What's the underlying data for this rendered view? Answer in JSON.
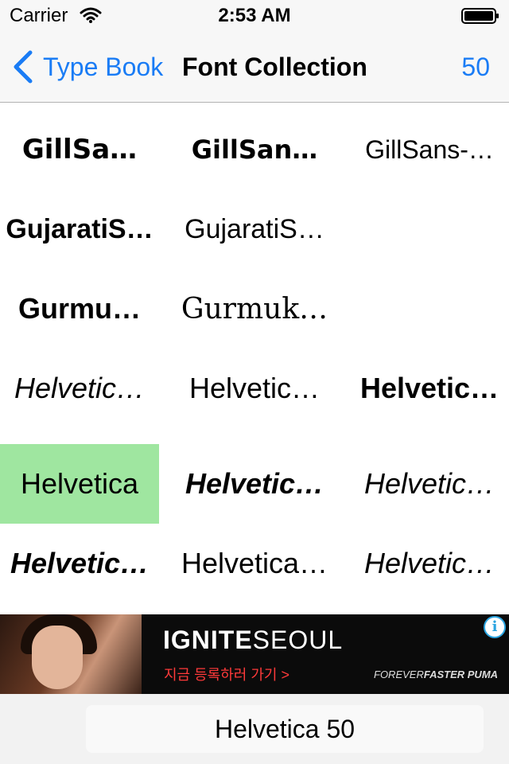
{
  "status_bar": {
    "carrier": "Carrier",
    "time": "2:53 AM",
    "wifi_icon": "wifi-icon",
    "battery_icon": "battery-icon"
  },
  "nav": {
    "back_label": "Type Book",
    "title": "Font Collection",
    "right_label": "50",
    "accent_color": "#1a7cf5"
  },
  "font_grid": {
    "rows": [
      [
        "GillSa…",
        "GillSan…",
        "GillSans-…"
      ],
      [
        "GujaratiS…",
        "GujaratiS…"
      ],
      [
        "Gurmu…",
        "Gurmuk…"
      ],
      [
        "Helvetic…",
        "Helvetic…",
        "Helvetic…"
      ],
      [
        "Helvetica",
        "Helvetic…",
        "Helvetic…"
      ],
      [
        "Helvetic…",
        "Helvetica…",
        "Helvetic…"
      ]
    ],
    "selected_label": "Helvetica",
    "selected_color": "#9fe6a0"
  },
  "ad": {
    "brand_bold": "IGNITE",
    "brand_light": "SEOUL",
    "cta": "지금 등록하러 가기 >",
    "tagline_light": "FOREVER",
    "tagline_bold": "FASTER",
    "tagline_logo": "PUMA",
    "info_icon": "info-icon",
    "info_glyph": "i"
  },
  "bottom": {
    "button_label": "Helvetica 50"
  }
}
